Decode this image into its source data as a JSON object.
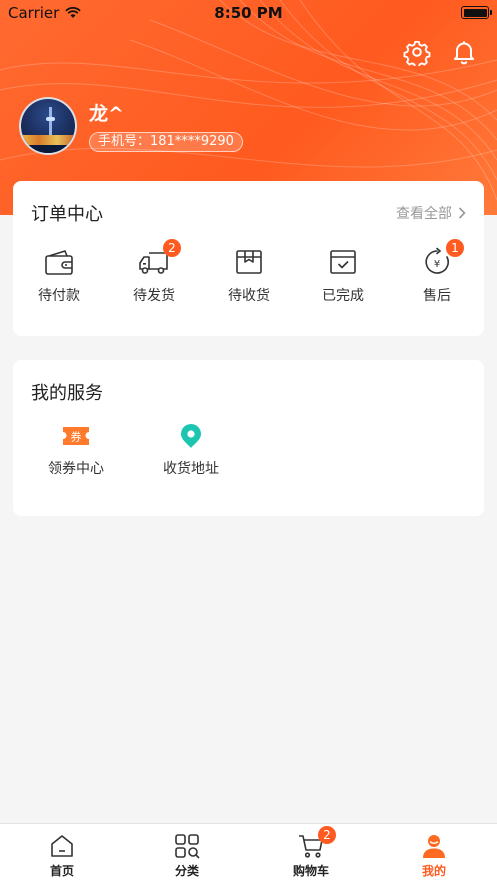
{
  "status_bar": {
    "carrier": "Carrier",
    "time": "8:50 PM"
  },
  "header": {
    "username": "龙^",
    "phone": "手机号：181****9290",
    "icons": [
      "settings-icon",
      "bell-icon"
    ]
  },
  "orders": {
    "title": "订单中心",
    "view_all": "查看全部",
    "items": [
      {
        "label": "待付款",
        "icon": "wallet-icon",
        "badge": ""
      },
      {
        "label": "待发货",
        "icon": "truck-icon",
        "badge": "2"
      },
      {
        "label": "待收货",
        "icon": "package-icon",
        "badge": ""
      },
      {
        "label": "已完成",
        "icon": "completed-box-icon",
        "badge": ""
      },
      {
        "label": "售后",
        "icon": "refund-icon",
        "badge": "1"
      }
    ]
  },
  "services": {
    "title": "我的服务",
    "items": [
      {
        "label": "领券中心",
        "icon": "coupon-icon",
        "icon_text": "券"
      },
      {
        "label": "收货地址",
        "icon": "location-pin-icon"
      }
    ]
  },
  "tabbar": {
    "items": [
      {
        "label": "首页",
        "icon": "home-icon",
        "badge": ""
      },
      {
        "label": "分类",
        "icon": "category-grid-icon",
        "badge": ""
      },
      {
        "label": "购物车",
        "icon": "cart-icon",
        "badge": "2"
      },
      {
        "label": "我的",
        "icon": "user-icon",
        "badge": "",
        "active": true
      }
    ]
  },
  "colors": {
    "brand": "#ff5a1f",
    "teal": "#1cc5b0",
    "background": "#f5f5f5"
  }
}
